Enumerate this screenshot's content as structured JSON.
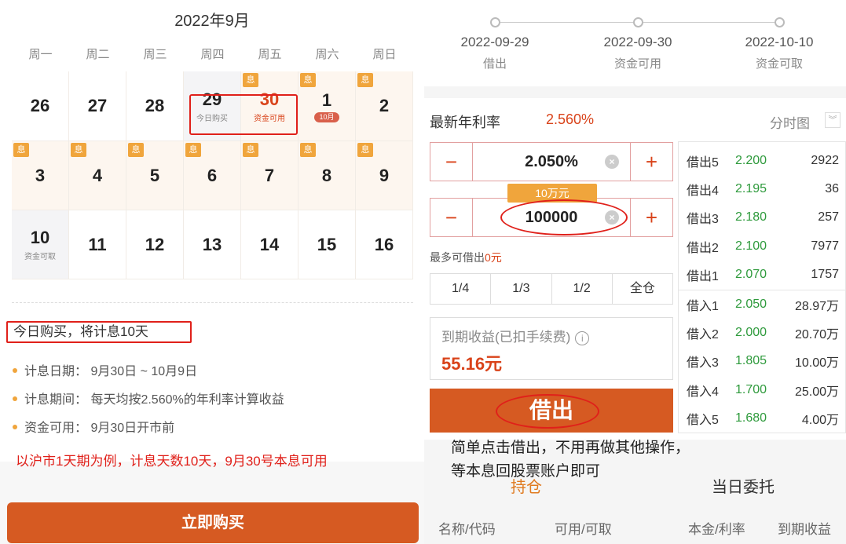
{
  "left": {
    "month_title": "2022年9月",
    "weekdays": [
      "周一",
      "周二",
      "周三",
      "周四",
      "周五",
      "周六",
      "周日"
    ],
    "days": [
      {
        "n": "26",
        "sub": "",
        "badge": "",
        "bg": ""
      },
      {
        "n": "27",
        "sub": "",
        "badge": "",
        "bg": ""
      },
      {
        "n": "28",
        "sub": "",
        "badge": "",
        "bg": ""
      },
      {
        "n": "29",
        "sub": "今日购买",
        "badge": "",
        "bg": "gray"
      },
      {
        "n": "30",
        "sub": "资金可用",
        "badge": "息",
        "bg": "warm",
        "red": true
      },
      {
        "n": "1",
        "sub": "",
        "pill": "10月",
        "badge": "息",
        "bg": "warm"
      },
      {
        "n": "2",
        "sub": "",
        "badge": "息",
        "bg": "warm"
      },
      {
        "n": "3",
        "sub": "",
        "badge": "息",
        "bg": "warm"
      },
      {
        "n": "4",
        "sub": "",
        "badge": "息",
        "bg": "warm"
      },
      {
        "n": "5",
        "sub": "",
        "badge": "息",
        "bg": "warm"
      },
      {
        "n": "6",
        "sub": "",
        "badge": "息",
        "bg": "warm"
      },
      {
        "n": "7",
        "sub": "",
        "badge": "息",
        "bg": "warm"
      },
      {
        "n": "8",
        "sub": "",
        "badge": "息",
        "bg": "warm"
      },
      {
        "n": "9",
        "sub": "",
        "badge": "息",
        "bg": "warm"
      },
      {
        "n": "10",
        "sub": "资金可取",
        "badge": "",
        "bg": "gray"
      },
      {
        "n": "11",
        "sub": "",
        "badge": "",
        "bg": ""
      },
      {
        "n": "12",
        "sub": "",
        "badge": "",
        "bg": ""
      },
      {
        "n": "13",
        "sub": "",
        "badge": "",
        "bg": ""
      },
      {
        "n": "14",
        "sub": "",
        "badge": "",
        "bg": ""
      },
      {
        "n": "15",
        "sub": "",
        "badge": "",
        "bg": ""
      },
      {
        "n": "16",
        "sub": "",
        "badge": "",
        "bg": ""
      }
    ],
    "today_note": "今日购买，将计息10天",
    "info": [
      "计息日期：  9月30日 ~ 10月9日",
      "计息期间：  每天均按2.560%的年利率计算收益",
      "资金可用：  9月30日开市前"
    ],
    "red_note": "以沪市1天期为例，计息天数10天，9月30号本息可用",
    "buy_button": "立即购买"
  },
  "right": {
    "steps": [
      {
        "date": "2022-09-29",
        "label": "借出"
      },
      {
        "date": "2022-09-30",
        "label": "资金可用"
      },
      {
        "date": "2022-10-10",
        "label": "资金可取"
      }
    ],
    "rate_label": "最新年利率",
    "rate_value": "2.560%",
    "timeshare": "分时图",
    "price_value": "2.050%",
    "amount_value": "100000",
    "amount_tip": "10万元",
    "max_label": "最多可借出",
    "max_value": "0元",
    "fractions": [
      "1/4",
      "1/3",
      "1/2",
      "全仓"
    ],
    "income_label": "到期收益(已扣手续费)",
    "income_value": "55.16元",
    "lend_button": "借出",
    "book": [
      {
        "a": "借出5",
        "p": "2.200",
        "q": "2922"
      },
      {
        "a": "借出4",
        "p": "2.195",
        "q": "36"
      },
      {
        "a": "借出3",
        "p": "2.180",
        "q": "257"
      },
      {
        "a": "借出2",
        "p": "2.100",
        "q": "7977"
      },
      {
        "a": "借出1",
        "p": "2.070",
        "q": "1757"
      },
      {
        "a": "借入1",
        "p": "2.050",
        "q": "28.97万"
      },
      {
        "a": "借入2",
        "p": "2.000",
        "q": "20.70万"
      },
      {
        "a": "借入3",
        "p": "1.805",
        "q": "10.00万"
      },
      {
        "a": "借入4",
        "p": "1.700",
        "q": "25.00万"
      },
      {
        "a": "借入5",
        "p": "1.680",
        "q": "4.00万"
      }
    ],
    "overlay_note_1": "简单点击借出，不用再做其他操作，",
    "overlay_note_2": "等本息回股票账户即可",
    "tab_hold": "持仓",
    "tab_entrust": "当日委托",
    "columns": [
      "名称/代码",
      "可用/可取",
      "本金/利率",
      "到期收益"
    ]
  }
}
